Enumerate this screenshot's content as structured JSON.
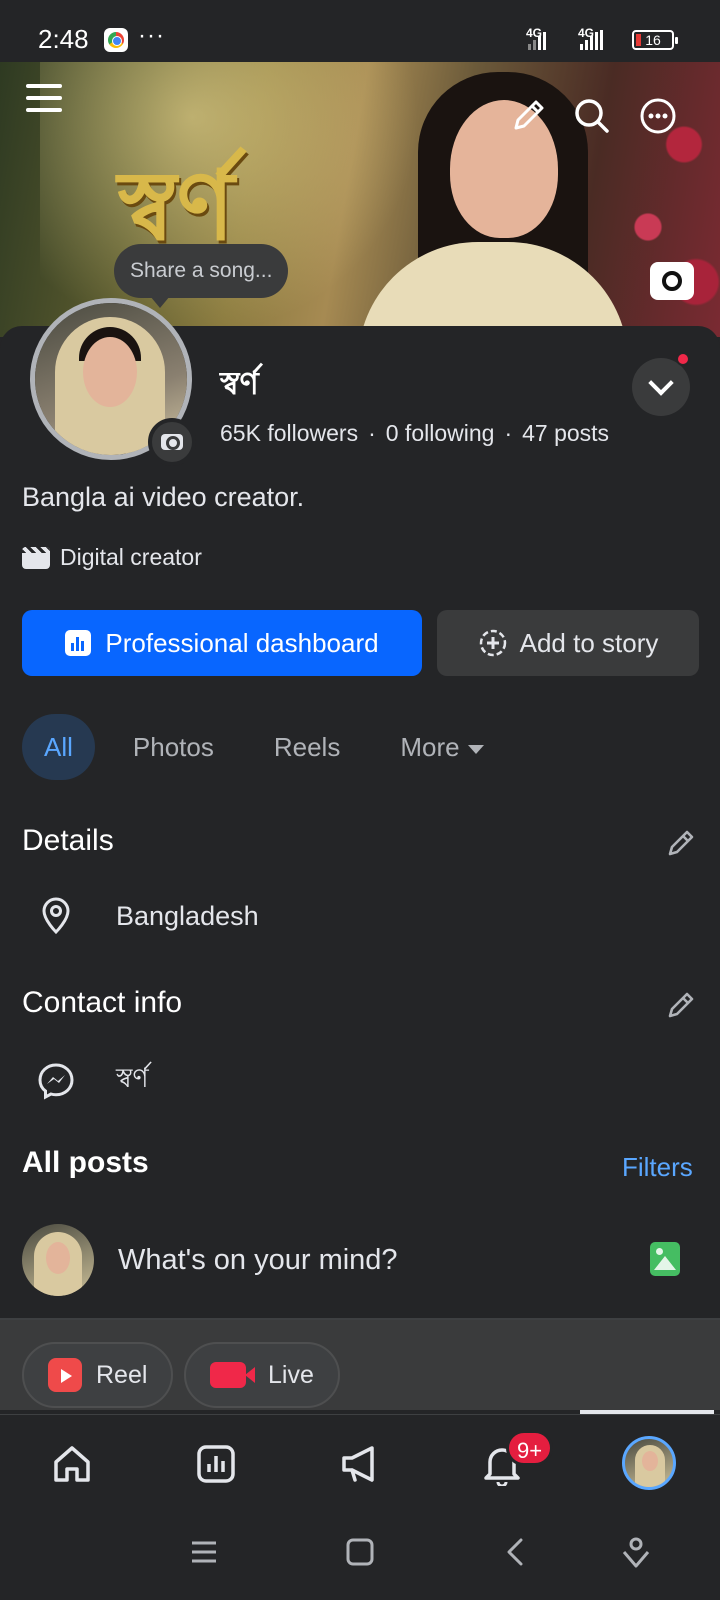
{
  "status_bar": {
    "time": "2:48",
    "more": "···",
    "network_1": "4G",
    "network_2": "4G",
    "battery": "16"
  },
  "cover": {
    "title": "স্বর্ণ",
    "share_song": "Share a song..."
  },
  "profile": {
    "name": "স্বর্ণ",
    "followers": "65K followers",
    "following": "0 following",
    "posts": "47 posts",
    "separator": "·",
    "bio": "Bangla ai video creator.",
    "category": "Digital creator"
  },
  "actions": {
    "primary": "Professional dashboard",
    "secondary": "Add to story"
  },
  "tabs": [
    {
      "label": "All",
      "active": true
    },
    {
      "label": "Photos",
      "active": false
    },
    {
      "label": "Reels",
      "active": false
    },
    {
      "label": "More",
      "active": false
    }
  ],
  "details": {
    "title": "Details",
    "location": "Bangladesh"
  },
  "contact": {
    "title": "Contact info",
    "messenger": "স্বর্ণ"
  },
  "posts": {
    "title": "All posts",
    "filters": "Filters",
    "composer_placeholder": "What's on your mind?"
  },
  "chips": {
    "reel": "Reel",
    "live": "Live"
  },
  "bottom_nav": {
    "notification_badge": "9+"
  },
  "colors": {
    "background": "#242527",
    "accent": "#0866ff",
    "link": "#5aa7ff",
    "badge": "#e41e3f"
  },
  "icons": [
    "menu-icon",
    "edit-icon",
    "search-icon",
    "more-icon",
    "camera-icon",
    "chevron-down-icon",
    "dashboard-icon",
    "add-story-icon",
    "location-icon",
    "messenger-icon",
    "photo-icon",
    "reel-icon",
    "live-icon",
    "home-icon",
    "insights-icon",
    "megaphone-icon",
    "bell-icon"
  ]
}
